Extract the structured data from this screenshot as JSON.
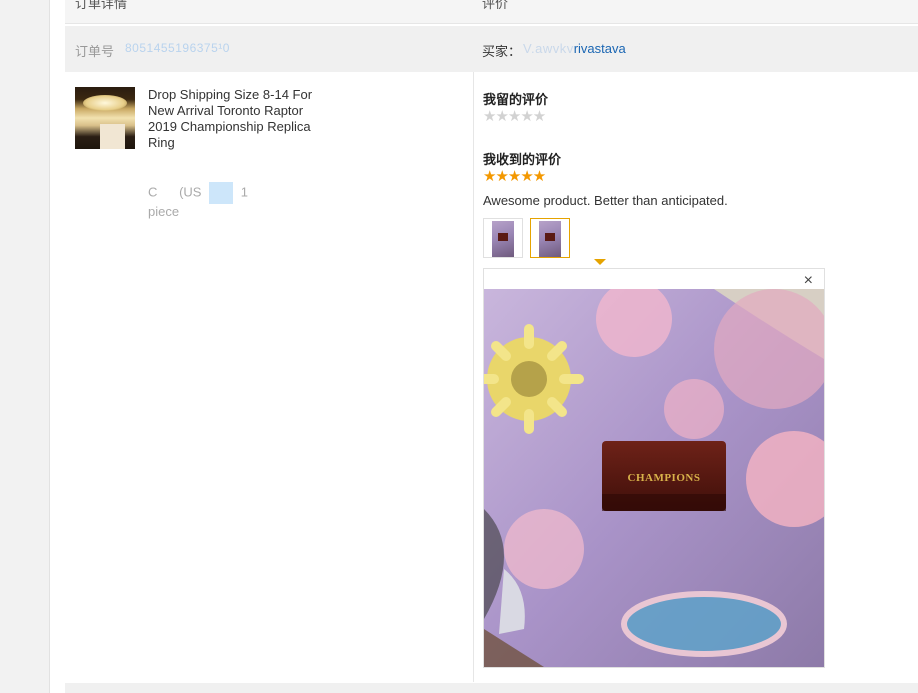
{
  "header": {
    "col_order_details": "订单详情",
    "col_review": "评价"
  },
  "order": {
    "label": "订单号",
    "number": "8051455196375¹0",
    "buyer_label": "买家：",
    "buyer_name_obscured": "V.awvkv",
    "buyer_name_visible": "rivastava"
  },
  "product": {
    "title": "Drop Shipping Size 8-14 For New Arrival Toronto Raptor 2019 Championship Replica Ring",
    "meta_prefix": "C",
    "meta_middle": "(US",
    "meta_suffix": "1",
    "meta_unit": "piece"
  },
  "my_review": {
    "title": "我留的评价",
    "rating": 0,
    "stars": "★★★★★"
  },
  "received_review": {
    "title": "我收到的评价",
    "rating": 5,
    "stars": "★★★★★",
    "text": "Awesome product. Better than anticipated."
  },
  "photo_viewer": {
    "close_glyph": "×",
    "box_label": "CHAMPIONS"
  },
  "colors": {
    "star_filled": "#f39800",
    "star_empty": "#d2d2d2",
    "link": "#1a66b3",
    "active_border": "#e5a300"
  }
}
